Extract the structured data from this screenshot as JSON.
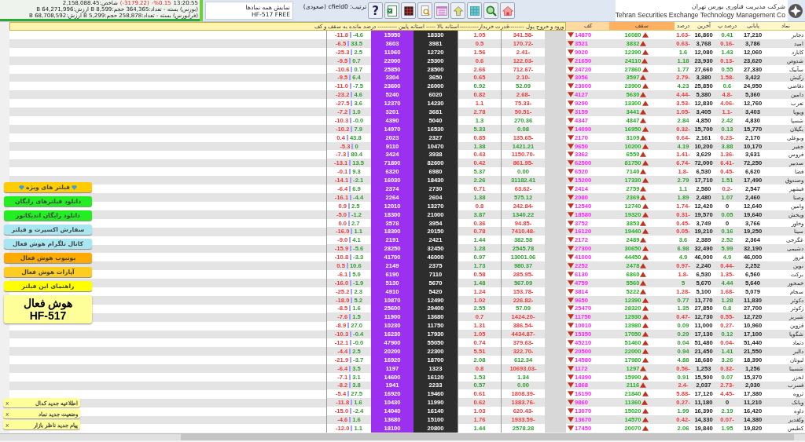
{
  "market_summary": {
    "time": "13:20:55",
    "index_pct": "%0.15-",
    "index_change": "(3179.22-)",
    "index_value": "شاخص:2,158,088.45",
    "bourse_line": "(بورس) بسته - تعداد:364,365 حجم:8,599 B ارزش:64,271,996 B",
    "farabourse_line": "(فرابورس) بسته - تعداد:258,878 حجم:5,299 B ارزش:68,708,592 B"
  },
  "view": {
    "title": "نمایش همه نمادها",
    "version": "HF-517 FREE"
  },
  "sort": {
    "label": "ترتیب: cfield0 (صعودی)"
  },
  "toolbar": [
    {
      "kind": "help",
      "label": "?"
    },
    {
      "kind": "excel"
    },
    {
      "kind": "grid"
    },
    {
      "kind": "preview"
    },
    {
      "kind": "calendar"
    },
    {
      "kind": "up"
    },
    {
      "kind": "table"
    },
    {
      "kind": "search"
    },
    {
      "kind": "home"
    }
  ],
  "company": {
    "name_fa": "شرکت مدیریت فناوری بورس تهران",
    "name_en": "Tehran Securities Exchange Technology Management Co"
  },
  "table": {
    "columns": [
      {
        "label": "نماد"
      },
      {
        "label": "پایانی"
      },
      {
        "label": "درصد پ"
      },
      {
        "label": "آخرین"
      },
      {
        "label": "درصد"
      },
      {
        "label": "سقف"
      },
      {
        "label": "کف"
      }
    ],
    "combined_header": "ورود و خروج پول --------قدرت خریدار----------استانه بالا ----- استانه پایین ---------- درصد مانده به سقف و کف",
    "rows": [
      {
        "symbol": "دجابر",
        "close": "17,210",
        "close_pct": "0.41",
        "last": "16,860",
        "last_pct": "-1.63",
        "ceiling": "16080",
        "floor": "14870",
        "money_flow": "-341.58",
        "buyer_power": "1.05",
        "upper": "18330",
        "lower": "15950",
        "remaining": [
          "-11.8",
          "-4.6"
        ]
      },
      {
        "symbol": "امید",
        "close": "3,786",
        "close_pct": "-0.16",
        "last": "3,768",
        "last_pct": "-0.63",
        "ceiling": "3832",
        "floor": "3521",
        "money_flow": "-170.72",
        "buyer_power": "0.5",
        "upper": "3981",
        "lower": "3603",
        "remaining": [
          "-6.5",
          "33.5"
        ]
      },
      {
        "symbol": "کابارد",
        "close": "12,060",
        "close_pct": "1.43",
        "last": "12,080",
        "last_pct": "1.6",
        "ceiling": "12390",
        "floor": "9020",
        "money_flow": "-2.41",
        "buyer_power": "1.56",
        "upper": "12720",
        "lower": "11060",
        "remaining": [
          "-25.3",
          "2.5"
        ]
      },
      {
        "symbol": "شدوص",
        "close": "23,620",
        "close_pct": "-0.13",
        "last": "23,930",
        "last_pct": "1.18",
        "ceiling": "24110",
        "floor": "21650",
        "money_flow": "-122.03",
        "buyer_power": "0.6",
        "upper": "25300",
        "lower": "22000",
        "remaining": [
          "-9.5",
          "0.7"
        ]
      },
      {
        "symbol": "سآبیک",
        "close": "27,330",
        "close_pct": "0.55",
        "last": "27,660",
        "last_pct": "1.77",
        "ceiling": "27860",
        "floor": "24720",
        "money_flow": "-712.67",
        "buyer_power": "2.66",
        "upper": "28500",
        "lower": "25850",
        "remaining": [
          "-10.6",
          "0.7"
        ]
      },
      {
        "symbol": "رکیش",
        "close": "3,422",
        "close_pct": "-1.58",
        "last": "3,380",
        "last_pct": "-2.79",
        "ceiling": "3597",
        "floor": "3056",
        "money_flow": "-2.10",
        "buyer_power": "0.65",
        "upper": "3650",
        "lower": "3304",
        "remaining": [
          "-9.5",
          "6.4"
        ]
      },
      {
        "symbol": "دقاضی",
        "close": "24,950",
        "close_pct": "0.6",
        "last": "25,850",
        "last_pct": "4.23",
        "ceiling": "23900",
        "floor": "23000",
        "money_flow": "52.09",
        "buyer_power": "0.92",
        "upper": "26000",
        "lower": "23600",
        "remaining": [
          "-11.0",
          "-7.5"
        ]
      },
      {
        "symbol": "دامین",
        "close": "5,360",
        "close_pct": "-4.8",
        "last": "5,380",
        "last_pct": "-4.44",
        "ceiling": "5630",
        "floor": "4127",
        "money_flow": "-2.68",
        "buyer_power": "0.82",
        "upper": "6020",
        "lower": "5240",
        "remaining": [
          "-23.2",
          "4.6"
        ]
      },
      {
        "symbol": "تعرب",
        "close": "12,760",
        "close_pct": "-4.06",
        "last": "12,830",
        "last_pct": "-3.53",
        "ceiling": "13300",
        "floor": "9290",
        "money_flow": "-75.33",
        "buyer_power": "1.1",
        "upper": "14230",
        "lower": "12370",
        "remaining": [
          "-27.5",
          "3.6"
        ]
      },
      {
        "symbol": "وپویا",
        "close": "3,403",
        "close_pct": "-1.1",
        "last": "3,405",
        "last_pct": "-1.05",
        "ceiling": "3441",
        "floor": "3159",
        "money_flow": "-50.51",
        "buyer_power": "2.78",
        "upper": "3681",
        "lower": "3201",
        "remaining": [
          "-7.2",
          "1.0"
        ]
      },
      {
        "symbol": "شسپا",
        "close": "4,830",
        "close_pct": "2.42",
        "last": "4,850",
        "last_pct": "2.84",
        "ceiling": "4847",
        "floor": "4347",
        "money_flow": "270.36",
        "buyer_power": "1.3",
        "upper": "5040",
        "lower": "4390",
        "remaining": [
          "-10.3",
          "-0.0"
        ]
      },
      {
        "symbol": "بگیلان",
        "close": "15,770",
        "close_pct": "0.13",
        "last": "15,700",
        "last_pct": "-0.32",
        "ceiling": "16950",
        "floor": "14090",
        "money_flow": "0.08",
        "buyer_power": "5.33",
        "upper": "16530",
        "lower": "14970",
        "remaining": [
          "-10.2",
          "7.9"
        ]
      },
      {
        "symbol": "وبوعلی",
        "close": "2,170",
        "close_pct": "-0.23",
        "last": "2,161",
        "last_pct": "-0.64",
        "ceiling": "3109",
        "floor": "2170",
        "money_flow": "-135.65",
        "buyer_power": "0.85",
        "upper": "2327",
        "lower": "2023",
        "remaining": [
          "0.4",
          "43.8"
        ]
      },
      {
        "symbol": "جفیر",
        "close": "10,170",
        "close_pct": "3.88",
        "last": "10,200",
        "last_pct": "4.19",
        "ceiling": "10200",
        "floor": "9650",
        "money_flow": "1421.21",
        "buyer_power": "1.38",
        "upper": "10470",
        "lower": "9110",
        "remaining": [
          "-5.3",
          "0"
        ]
      },
      {
        "symbol": "فروس",
        "close": "3,631",
        "close_pct": "-1.36",
        "last": "3,629",
        "last_pct": "-1.41",
        "ceiling": "6550",
        "floor": "3362",
        "money_flow": "-1150.70",
        "buyer_power": "0.43",
        "upper": "3938",
        "lower": "3424",
        "remaining": [
          "-7.3",
          "80.4"
        ]
      },
      {
        "symbol": "سدبیر",
        "close": "72,250",
        "close_pct": "-6.41",
        "last": "72,000",
        "last_pct": "-6.74",
        "ceiling": "81750",
        "floor": "62500",
        "money_flow": "-861.95",
        "buyer_power": "0.42",
        "upper": "82600",
        "lower": "71800",
        "remaining": [
          "-13.1",
          "13.5"
        ]
      },
      {
        "symbol": "فضا",
        "close": "6,620",
        "close_pct": "-0.45",
        "last": "6,530",
        "last_pct": "-1.8",
        "ceiling": "7140",
        "floor": "6520",
        "money_flow": "0.00",
        "buyer_power": "5.37",
        "upper": "6980",
        "lower": "6320",
        "remaining": [
          "-0.1",
          "9.3"
        ]
      },
      {
        "symbol": "وصندوق",
        "close": "17,490",
        "close_pct": "1.51",
        "last": "17,710",
        "last_pct": "2.79",
        "ceiling": "17330",
        "floor": "15200",
        "money_flow": "31182.41",
        "buyer_power": "2.26",
        "upper": "18430",
        "lower": "16030",
        "remaining": [
          "-14.1",
          "-2.1"
        ]
      },
      {
        "symbol": "فبشهر",
        "close": "2,547",
        "close_pct": "-0.2",
        "last": "2,580",
        "last_pct": "1.1",
        "ceiling": "2759",
        "floor": "2414",
        "money_flow": "-63.62",
        "buyer_power": "0.71",
        "upper": "2730",
        "lower": "2374",
        "remaining": [
          "-6.4",
          "6.9"
        ]
      },
      {
        "symbol": "وصنا",
        "close": "2,460",
        "close_pct": "1.07",
        "last": "2,480",
        "last_pct": "1.89",
        "ceiling": "2369",
        "floor": "2080",
        "money_flow": "575.12",
        "buyer_power": "1.38",
        "upper": "2604",
        "lower": "2264",
        "remaining": [
          "-16.1",
          "-4.4"
        ]
      },
      {
        "symbol": "وامین",
        "close": "12,640",
        "close_pct": "0",
        "last": "12,420",
        "last_pct": "-1.74",
        "ceiling": "12740",
        "floor": "12540",
        "money_flow": "-242.84",
        "buyer_power": "0.8",
        "upper": "13270",
        "lower": "12010",
        "remaining": [
          "0.9",
          "2.5"
        ]
      },
      {
        "symbol": "وپخش",
        "close": "19,640",
        "close_pct": "0.05",
        "last": "19,570",
        "last_pct": "-0.31",
        "ceiling": "19320",
        "floor": "18580",
        "money_flow": "1340.22",
        "buyer_power": "3.87",
        "upper": "21000",
        "lower": "18300",
        "remaining": [
          "-5.0",
          "-1.2"
        ]
      },
      {
        "symbol": "وخاور",
        "close": "3,766",
        "close_pct": "0",
        "last": "3,749",
        "last_pct": "-0.45",
        "ceiling": "3853",
        "floor": "3752",
        "money_flow": "-94.85",
        "buyer_power": "0.36",
        "upper": "3954",
        "lower": "3578",
        "remaining": [
          "0.0",
          "2.7"
        ]
      },
      {
        "symbol": "سینا",
        "close": "19,250",
        "close_pct": "0.16",
        "last": "19,210",
        "last_pct": "-0.05",
        "ceiling": "19440",
        "floor": "16120",
        "money_flow": "-7410.48",
        "buyer_power": "0.78",
        "upper": "20150",
        "lower": "18300",
        "remaining": [
          "-16.0",
          "1.1"
        ]
      },
      {
        "symbol": "غگرجی",
        "close": "2,364",
        "close_pct": "2.52",
        "last": "2,389",
        "last_pct": "3.6",
        "ceiling": "2489",
        "floor": "2172",
        "money_flow": "382.58",
        "buyer_power": "1.44",
        "upper": "2421",
        "lower": "2191",
        "remaining": [
          "-9.0",
          "4.1"
        ]
      },
      {
        "symbol": "دشیمی",
        "close": "32,190",
        "close_pct": "5.99",
        "last": "32,490",
        "last_pct": "6.98",
        "ceiling": "30650",
        "floor": "27300",
        "money_flow": "2545.78",
        "buyer_power": "1.28",
        "upper": "32450",
        "lower": "28250",
        "remaining": [
          "-15.9",
          "-5.6"
        ]
      },
      {
        "symbol": "فروز",
        "close": "46,000",
        "close_pct": "4.9",
        "last": "46,000",
        "last_pct": "4.9",
        "ceiling": "44450",
        "floor": "41000",
        "money_flow": "13001.06",
        "buyer_power": "0.97",
        "upper": "46000",
        "lower": "41700",
        "remaining": [
          "-10.8",
          "-3.3"
        ]
      },
      {
        "symbol": "نوین",
        "close": "2,252",
        "close_pct": "-0.44",
        "last": "2,240",
        "last_pct": "-0.97",
        "ceiling": "2478",
        "floor": "2252",
        "money_flow": "980.37",
        "buyer_power": "1.73",
        "upper": "2375",
        "lower": "2149",
        "remaining": [
          "0.5",
          "10.6"
        ]
      },
      {
        "symbol": "برکت",
        "close": "6,560",
        "close_pct": "-1.35",
        "last": "6,530",
        "last_pct": "-1.8",
        "ceiling": "6860",
        "floor": "6130",
        "money_flow": "-285.95",
        "buyer_power": "0.58",
        "upper": "7110",
        "lower": "6190",
        "remaining": [
          "-6.1",
          "5.0"
        ]
      },
      {
        "symbol": "خمحور",
        "close": "5,640",
        "close_pct": "4.44",
        "last": "5,670",
        "last_pct": "5",
        "ceiling": "5560",
        "floor": "4759",
        "money_flow": "567.09",
        "buyer_power": "1.48",
        "upper": "5670",
        "lower": "5130",
        "remaining": [
          "-16.0",
          "-1.9"
        ]
      },
      {
        "symbol": "سجام",
        "close": "5,079",
        "close_pct": "-1.68",
        "last": "5,100",
        "last_pct": "-1.28",
        "ceiling": "5222",
        "floor": "3814",
        "money_flow": "-153.78",
        "buyer_power": "1.24",
        "upper": "5420",
        "lower": "4910",
        "remaining": [
          "-25.2",
          "2.3"
        ]
      },
      {
        "symbol": "دکوثر",
        "close": "11,830",
        "close_pct": "1.28",
        "last": "11,770",
        "last_pct": "0.77",
        "ceiling": "12390",
        "floor": "9650",
        "money_flow": "-226.82",
        "buyer_power": "1.02",
        "upper": "12490",
        "lower": "10870",
        "remaining": [
          "-18.0",
          "5.2"
        ]
      },
      {
        "symbol": "زکوثر",
        "close": "27,700",
        "close_pct": "0.8",
        "last": "27,850",
        "last_pct": "1.35",
        "ceiling": "28320",
        "floor": "25470",
        "money_flow": "57.09",
        "buyer_power": "2.55",
        "upper": "29400",
        "lower": "25600",
        "remaining": [
          "-8.5",
          "1.6"
        ]
      },
      {
        "symbol": "شبریز",
        "close": "12,720",
        "close_pct": "-0.55",
        "last": "12,730",
        "last_pct": "-0.47",
        "ceiling": "12930",
        "floor": "11750",
        "money_flow": "-1424.20",
        "buyer_power": "0.7",
        "upper": "13680",
        "lower": "11900",
        "remaining": [
          "-7.6",
          "1.5"
        ]
      },
      {
        "symbol": "قزوین",
        "close": "10,960",
        "close_pct": "-0.27",
        "last": "11,000",
        "last_pct": "0.09",
        "ceiling": "13980",
        "floor": "10010",
        "money_flow": "-386.54",
        "buyer_power": "1.31",
        "upper": "11750",
        "lower": "10230",
        "remaining": [
          "-8.9",
          "27.0"
        ]
      },
      {
        "symbol": "شگویا",
        "close": "17,100",
        "close_pct": "0.12",
        "last": "17,130",
        "last_pct": "0.29",
        "ceiling": "17050",
        "floor": "15350",
        "money_flow": "-4434.87",
        "buyer_power": "1.05",
        "upper": "17930",
        "lower": "16230",
        "remaining": [
          "-10.3",
          "-0.4"
        ]
      },
      {
        "symbol": "دتماد",
        "close": "51,440",
        "close_pct": "-0.04",
        "last": "51,480",
        "last_pct": "0.04",
        "ceiling": "51460",
        "floor": "45210",
        "money_flow": "-379.63",
        "buyer_power": "0.74",
        "upper": "55050",
        "lower": "47900",
        "remaining": [
          "-12.1",
          "-0.0"
        ]
      },
      {
        "symbol": "دالبر",
        "close": "21,550",
        "close_pct": "1.41",
        "last": "21,450",
        "last_pct": "0.94",
        "ceiling": "22000",
        "floor": "20500",
        "money_flow": "-322.70",
        "buyer_power": "5.51",
        "upper": "22300",
        "lower": "20200",
        "remaining": [
          "-4.4",
          "2.5"
        ]
      },
      {
        "symbol": "لبوتان",
        "close": "18,390",
        "close_pct": "3.26",
        "last": "18,680",
        "last_pct": "4.88",
        "ceiling": "17980",
        "floor": "14580",
        "money_flow": "612.34",
        "buyer_power": "2.08",
        "upper": "18700",
        "lower": "16920",
        "remaining": [
          "-21.9",
          "-3.7"
        ]
      },
      {
        "symbol": "شسینا",
        "close": "1,256",
        "close_pct": "-0.32",
        "last": "1,253",
        "last_pct": "-0.56",
        "ceiling": "1297",
        "floor": "1172",
        "money_flow": "-10693.03",
        "buyer_power": "0.8",
        "upper": "1323",
        "lower": "1197",
        "remaining": [
          "-6.4",
          "3.5"
        ]
      },
      {
        "symbol": "لخزر",
        "close": "15,370",
        "close_pct": "0.07",
        "last": "15,500",
        "last_pct": "0.91",
        "ceiling": "15990",
        "floor": "14390",
        "money_flow": "1.34",
        "buyer_power": "1.53",
        "upper": "16120",
        "lower": "14600",
        "remaining": [
          "-7.1",
          "3.1"
        ]
      },
      {
        "symbol": "فسرب",
        "close": "2,030",
        "close_pct": "-2.73",
        "last": "2,037",
        "last_pct": "-2.4",
        "ceiling": "2116",
        "floor": "1868",
        "money_flow": "0.00",
        "buyer_power": "0.57",
        "upper": "2233",
        "lower": "1941",
        "remaining": [
          "-8.2",
          "3.8"
        ]
      },
      {
        "symbol": "ثروه",
        "close": "17,380",
        "close_pct": "-4.45",
        "last": "17,120",
        "last_pct": "-5.88",
        "ceiling": "21840",
        "floor": "16190",
        "money_flow": "-1808.39",
        "buyer_power": "0.61",
        "upper": "19460",
        "lower": "16920",
        "remaining": [
          "-5.4",
          "27.5"
        ]
      },
      {
        "symbol": "وبانک",
        "close": "11,210",
        "close_pct": "0",
        "last": "11,180",
        "last_pct": "-0.27",
        "ceiling": "11360",
        "floor": "9860",
        "money_flow": "-1383.76",
        "buyer_power": "0.62",
        "upper": "11990",
        "lower": "10430",
        "remaining": [
          "-11.8",
          "1.6"
        ]
      },
      {
        "symbol": "داوه",
        "close": "16,420",
        "close_pct": "2.19",
        "last": "16,390",
        "last_pct": "1.99",
        "ceiling": "15020",
        "floor": "13070",
        "money_flow": "-620.43",
        "buyer_power": "1.03",
        "upper": "16140",
        "lower": "14040",
        "remaining": [
          "-15.0",
          "-2.4"
        ]
      },
      {
        "symbol": "وکغدیر",
        "close": "14,380",
        "close_pct": "-0.07",
        "last": "14,330",
        "last_pct": "-0.42",
        "ceiling": "14570",
        "floor": "13670",
        "money_flow": "-1933.59",
        "buyer_power": "1.76",
        "upper": "15100",
        "lower": "13680",
        "remaining": [
          "-4.6",
          "1.6"
        ]
      },
      {
        "symbol": "کطبس",
        "close": "19,820",
        "close_pct": "1.95",
        "last": "19,840",
        "last_pct": "2.06",
        "ceiling": "20070",
        "floor": "17450",
        "money_flow": "2578.28",
        "buyer_power": "1.44",
        "upper": "20800",
        "lower": "18100",
        "remaining": [
          "-12.0",
          "1.1"
        ]
      }
    ]
  },
  "side_buttons": [
    {
      "label": "فیلتر های ویژه",
      "color": "#ffcc00",
      "diamonds": true
    },
    {
      "label": "دانلود فیلترهای رایگان",
      "color": "#22ee22",
      "diamonds": false
    },
    {
      "label": "دانلود رایگان اندیکاتور",
      "color": "#22ee22",
      "diamonds": false
    },
    {
      "label": "سفارش اکسپرت و فیلتر",
      "color": "#a8e6f2",
      "diamonds": false
    },
    {
      "label": "کانال تلگرام هوش فعال",
      "color": "#a8e6f2",
      "diamonds": false
    },
    {
      "label": "یوتیوب هوش فعال",
      "color": "#ffaa00",
      "diamonds": false
    },
    {
      "label": "آپارات هوش فعال",
      "color": "#ffcc22",
      "diamonds": false
    },
    {
      "label": "راهنمای این فیلتر",
      "color": "#ffff00",
      "diamonds": false
    }
  ],
  "brand": {
    "line1": "هوش فعال",
    "line2": "HF-517"
  },
  "notifications": [
    {
      "text": "اطلاعیه جدید کدال",
      "close": "x"
    },
    {
      "text": "وضعیت جدید نماد",
      "close": "x"
    },
    {
      "text": "پیام جدید ناظر بازار",
      "close": "x"
    }
  ]
}
